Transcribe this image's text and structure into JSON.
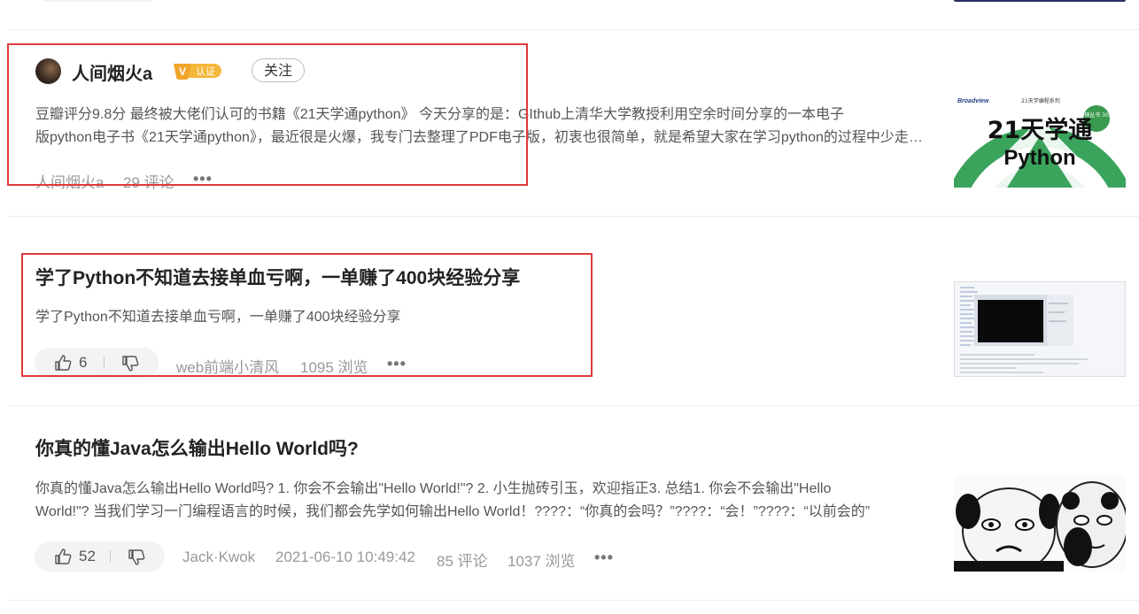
{
  "article1": {
    "author": "人间烟火a",
    "cert_label": "认证",
    "follow_label": "关注",
    "summary_line1": "豆瓣评分9.8分 最终被大佬们认可的书籍《21天学通python》 今天分享的是：GIthub上清华大学教授利用空余时间分享的一本电子",
    "summary_line2": "版python电子书《21天学通python》，最近很是火爆，我专门去整理了PDF电子版，初衷也很简单，就是希望大家在学习python的过程中少走弯路",
    "author_meta": "人间烟火a",
    "comments": "29 评论",
    "more": "•••",
    "thumb": {
      "publisher": "Broadview",
      "series": "21天学编程系列",
      "title_main": "21天学通",
      "title_lang": "Python",
      "seal": "畅销丛书 30万"
    }
  },
  "article2": {
    "title": "学了Python不知道去接单血亏啊，一单赚了400块经验分享",
    "summary": "学了Python不知道去接单血亏啊，一单赚了400块经验分享",
    "likes": "6",
    "author": "web前端小清风",
    "views": "1095 浏览",
    "more": "•••"
  },
  "article3": {
    "title": "你真的懂Java怎么输出Hello World吗?",
    "summary_line1": "你真的懂Java怎么输出Hello World吗? 1. 你会不会输出\"Hello World!\"? 2. 小生抛砖引玉，欢迎指正3. 总结1. 你会不会输出\"Hello",
    "summary_line2": "World!\"? 当我们学习一门编程语言的时候，我们都会先学如何输出Hello World！????：“你真的会吗？”????：“会！”????：“以前会的”",
    "likes": "52",
    "author": "Jack·Kwok",
    "date": "2021-06-10 10:49:42",
    "comments": "85 评论",
    "views": "1037 浏览",
    "more": "•••"
  },
  "colors": {
    "highlight_box": "#e0393b",
    "cert_badge": "#f5b73b",
    "meta_text": "#999999",
    "title_text": "#222222"
  }
}
